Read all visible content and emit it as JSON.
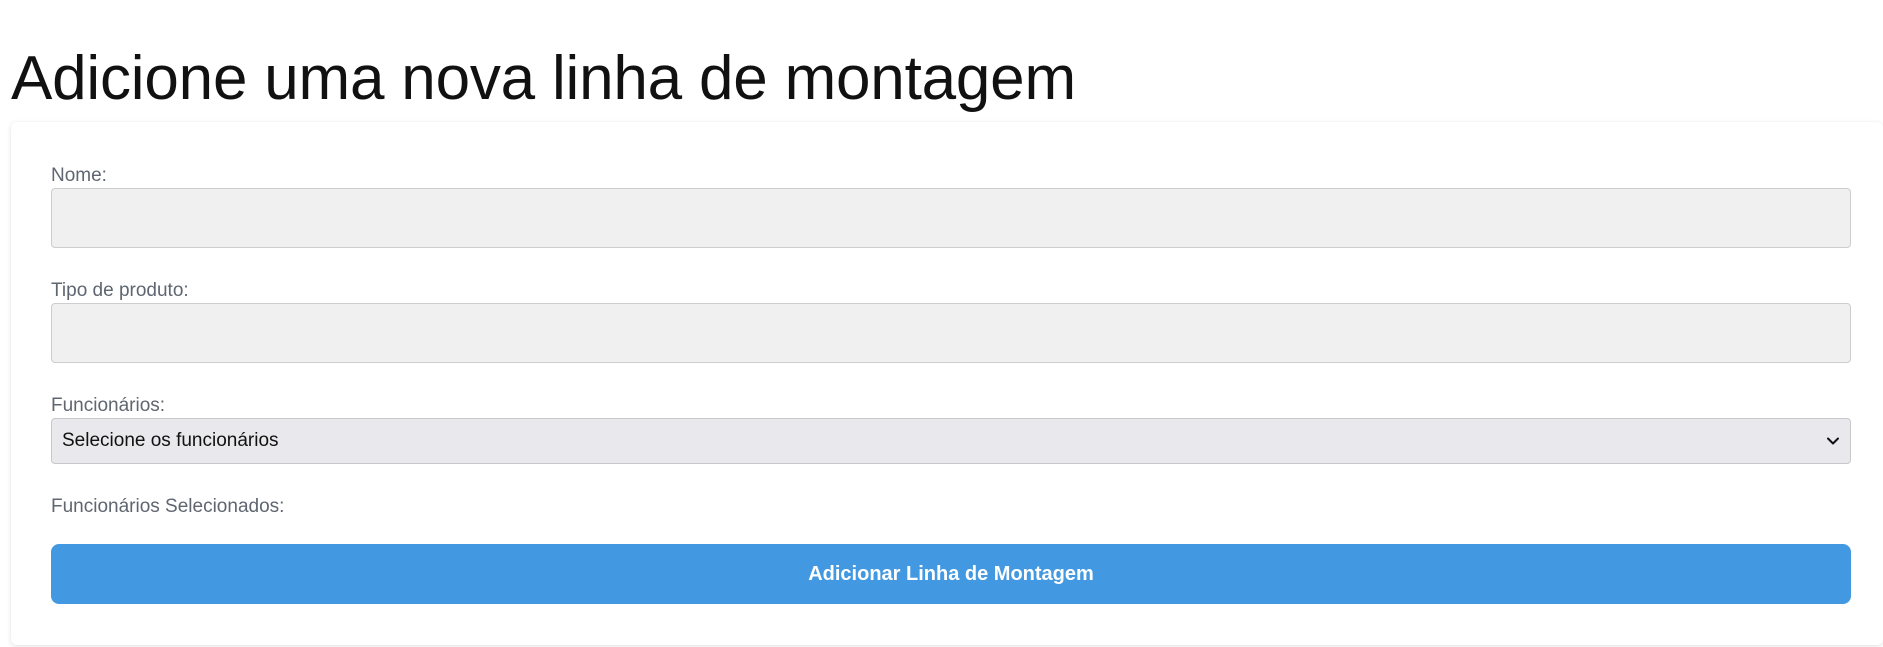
{
  "page": {
    "title": "Adicione uma nova linha de montagem"
  },
  "form": {
    "nome": {
      "label": "Nome:",
      "value": "",
      "placeholder": ""
    },
    "tipo_produto": {
      "label": "Tipo de produto:",
      "value": "",
      "placeholder": ""
    },
    "funcionarios": {
      "label": "Funcionários:",
      "selected": "Selecione os funcionários",
      "icon": "chevron-down-icon"
    },
    "selecionados": {
      "label": "Funcionários Selecionados:"
    },
    "submit": {
      "label": "Adicionar Linha de Montagem"
    }
  },
  "colors": {
    "accent": "#4299e1",
    "input_bg": "#f0f0f0",
    "label_text": "#5f6670"
  }
}
